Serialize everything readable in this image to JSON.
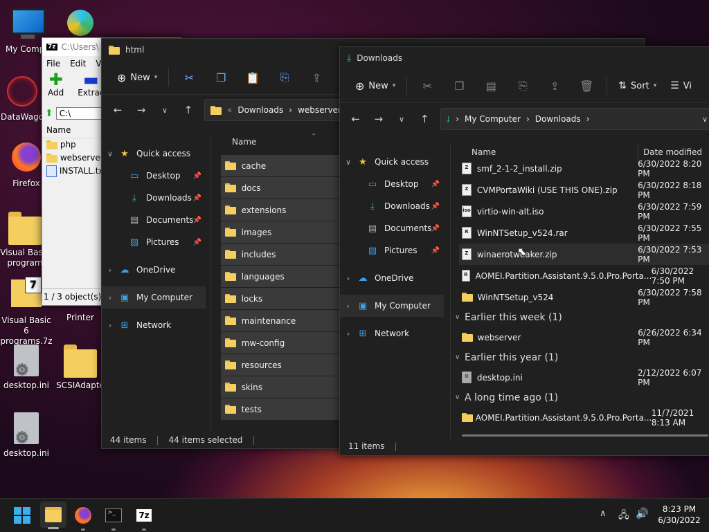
{
  "desktop": {
    "icons": [
      {
        "label": "My Compu"
      },
      {
        "label": ""
      },
      {
        "label": "DataWago"
      },
      {
        "label": "Firefox"
      },
      {
        "label": "Visual Basic"
      },
      {
        "label": "program"
      },
      {
        "label": "Visual Basic 6"
      },
      {
        "label": "programs.7z"
      },
      {
        "label": "Printer"
      },
      {
        "label": "desktop.ini"
      },
      {
        "label": "SCSIAdapte"
      },
      {
        "label": "desktop.ini"
      }
    ]
  },
  "sevenzip": {
    "title": "C:\\Users\\",
    "menu": [
      "File",
      "Edit",
      "V"
    ],
    "add_label": "Add",
    "extract_label": "Extrac",
    "path": "C:\\",
    "col_name": "Name",
    "items": [
      "php",
      "webserver",
      "INSTALL.txt"
    ],
    "status": "1 / 3 object(s) se"
  },
  "html_win": {
    "title": "html",
    "new_label": "New",
    "breadcrumb": [
      "Downloads",
      "webserver",
      "h"
    ],
    "col_name": "Name",
    "nav": {
      "quick_access": "Quick access",
      "desktop": "Desktop",
      "downloads": "Downloads",
      "documents": "Documents",
      "pictures": "Pictures",
      "onedrive": "OneDrive",
      "mycomputer": "My Computer",
      "network": "Network"
    },
    "folders": [
      "cache",
      "docs",
      "extensions",
      "images",
      "includes",
      "languages",
      "locks",
      "maintenance",
      "mw-config",
      "resources",
      "skins",
      "tests"
    ],
    "status_count": "44 items",
    "status_selected": "44 items selected"
  },
  "dl_win": {
    "title": "Downloads",
    "new_label": "New",
    "sort_label": "Sort",
    "view_label": "Vi",
    "breadcrumb": [
      "My Computer",
      "Downloads"
    ],
    "col_name": "Name",
    "col_date": "Date modified",
    "nav": {
      "quick_access": "Quick access",
      "desktop": "Desktop",
      "downloads": "Downloads",
      "documents": "Documents",
      "pictures": "Pictures",
      "onedrive": "OneDrive",
      "mycomputer": "My Computer",
      "network": "Network"
    },
    "files_today": [
      {
        "name": "smf_2-1-2_install.zip",
        "date": "6/30/2022 8:20 PM",
        "icon": "zip"
      },
      {
        "name": "CVMPortaWiki (USE THIS ONE).zip",
        "date": "6/30/2022 8:18 PM",
        "icon": "zip"
      },
      {
        "name": "virtio-win-alt.iso",
        "date": "6/30/2022 7:59 PM",
        "icon": "iso"
      },
      {
        "name": "WinNTSetup_v524.rar",
        "date": "6/30/2022 7:55 PM",
        "icon": "rar"
      },
      {
        "name": "winaerotweaker.zip",
        "date": "6/30/2022 7:53 PM",
        "icon": "zip"
      },
      {
        "name": "AOMEI.Partition.Assistant.9.5.0.Pro.Porta...",
        "date": "6/30/2022 7:50 PM",
        "icon": "rar"
      },
      {
        "name": "WinNTSetup_v524",
        "date": "6/30/2022 7:58 PM",
        "icon": "folder"
      }
    ],
    "group_week": "Earlier this week (1)",
    "week_item": {
      "name": "webserver",
      "date": "6/26/2022 6:34 PM"
    },
    "group_year": "Earlier this year (1)",
    "year_item": {
      "name": "desktop.ini",
      "date": "2/12/2022 6:07 PM"
    },
    "group_old": "A long time ago (1)",
    "old_item": {
      "name": "AOMEI.Partition.Assistant.9.5.0.Pro.Porta...",
      "date": "11/7/2021 8:13 AM"
    },
    "status_count": "11 items"
  },
  "taskbar": {
    "time": "8:23 PM",
    "date": "6/30/2022"
  },
  "colors": {
    "accent": "#4cc2ff",
    "folder": "#f4cf60",
    "window_bg": "#202020"
  }
}
